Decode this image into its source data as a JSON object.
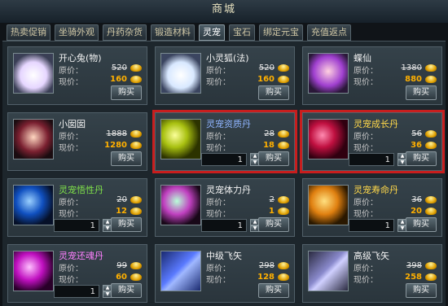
{
  "window": {
    "title": "商城"
  },
  "tabs": [
    "热卖促销",
    "坐骑外观",
    "丹药杂货",
    "锻造材料",
    "灵宠",
    "宝石",
    "绑定元宝",
    "充值返点"
  ],
  "active_tab_index": 4,
  "labels": {
    "original_price": "原价：",
    "current_price": "现价：",
    "buy": "购买"
  },
  "products": [
    {
      "name": "开心兔(物)",
      "orig": "520",
      "now": "160",
      "name_color": "white",
      "thumb": "rabbit-pet-icon",
      "qty": ""
    },
    {
      "name": "小灵狐(法)",
      "orig": "520",
      "now": "160",
      "name_color": "white",
      "thumb": "fox-pet-icon",
      "qty": ""
    },
    {
      "name": "蝶仙",
      "orig": "1380",
      "now": "880",
      "name_color": "white",
      "thumb": "butterfly-fairy-icon",
      "qty": ""
    },
    {
      "name": "小囡囡",
      "orig": "1888",
      "now": "1280",
      "name_color": "white",
      "thumb": "little-girl-pet-icon",
      "qty": ""
    },
    {
      "name": "灵宠资质丹",
      "orig": "28",
      "now": "18",
      "name_color": "blue",
      "thumb": "yellow-pill-icon",
      "qty": "1"
    },
    {
      "name": "灵宠成长丹",
      "orig": "56",
      "now": "36",
      "name_color": "gold",
      "thumb": "red-pill-icon",
      "qty": "1"
    },
    {
      "name": "灵宠悟性丹",
      "orig": "20",
      "now": "12",
      "name_color": "green",
      "thumb": "blue-pill-icon",
      "qty": "1"
    },
    {
      "name": "灵宠体力丹",
      "orig": "2",
      "now": "1",
      "name_color": "white",
      "thumb": "green-pill-icon",
      "qty": "1"
    },
    {
      "name": "灵宠寿命丹",
      "orig": "36",
      "now": "20",
      "name_color": "gold",
      "thumb": "orange-pill-icon",
      "qty": "1"
    },
    {
      "name": "灵宠还魂丹",
      "orig": "99",
      "now": "60",
      "name_color": "purple",
      "thumb": "magenta-pill-icon",
      "qty": "1"
    },
    {
      "name": "中级飞矢",
      "orig": "298",
      "now": "128",
      "name_color": "white",
      "thumb": "blue-scroll-icon",
      "qty": ""
    },
    {
      "name": "高级飞矢",
      "orig": "398",
      "now": "258",
      "name_color": "white",
      "thumb": "purple-scroll-icon",
      "qty": ""
    }
  ],
  "highlighted": [
    4,
    5
  ],
  "colors": {
    "name_green": "#7fe04a",
    "name_blue": "#8fb4ff",
    "name_gold": "#ffd84a",
    "name_purple": "#ff80ff",
    "price_now": "#ffb000",
    "highlight": "#c81e1e"
  }
}
